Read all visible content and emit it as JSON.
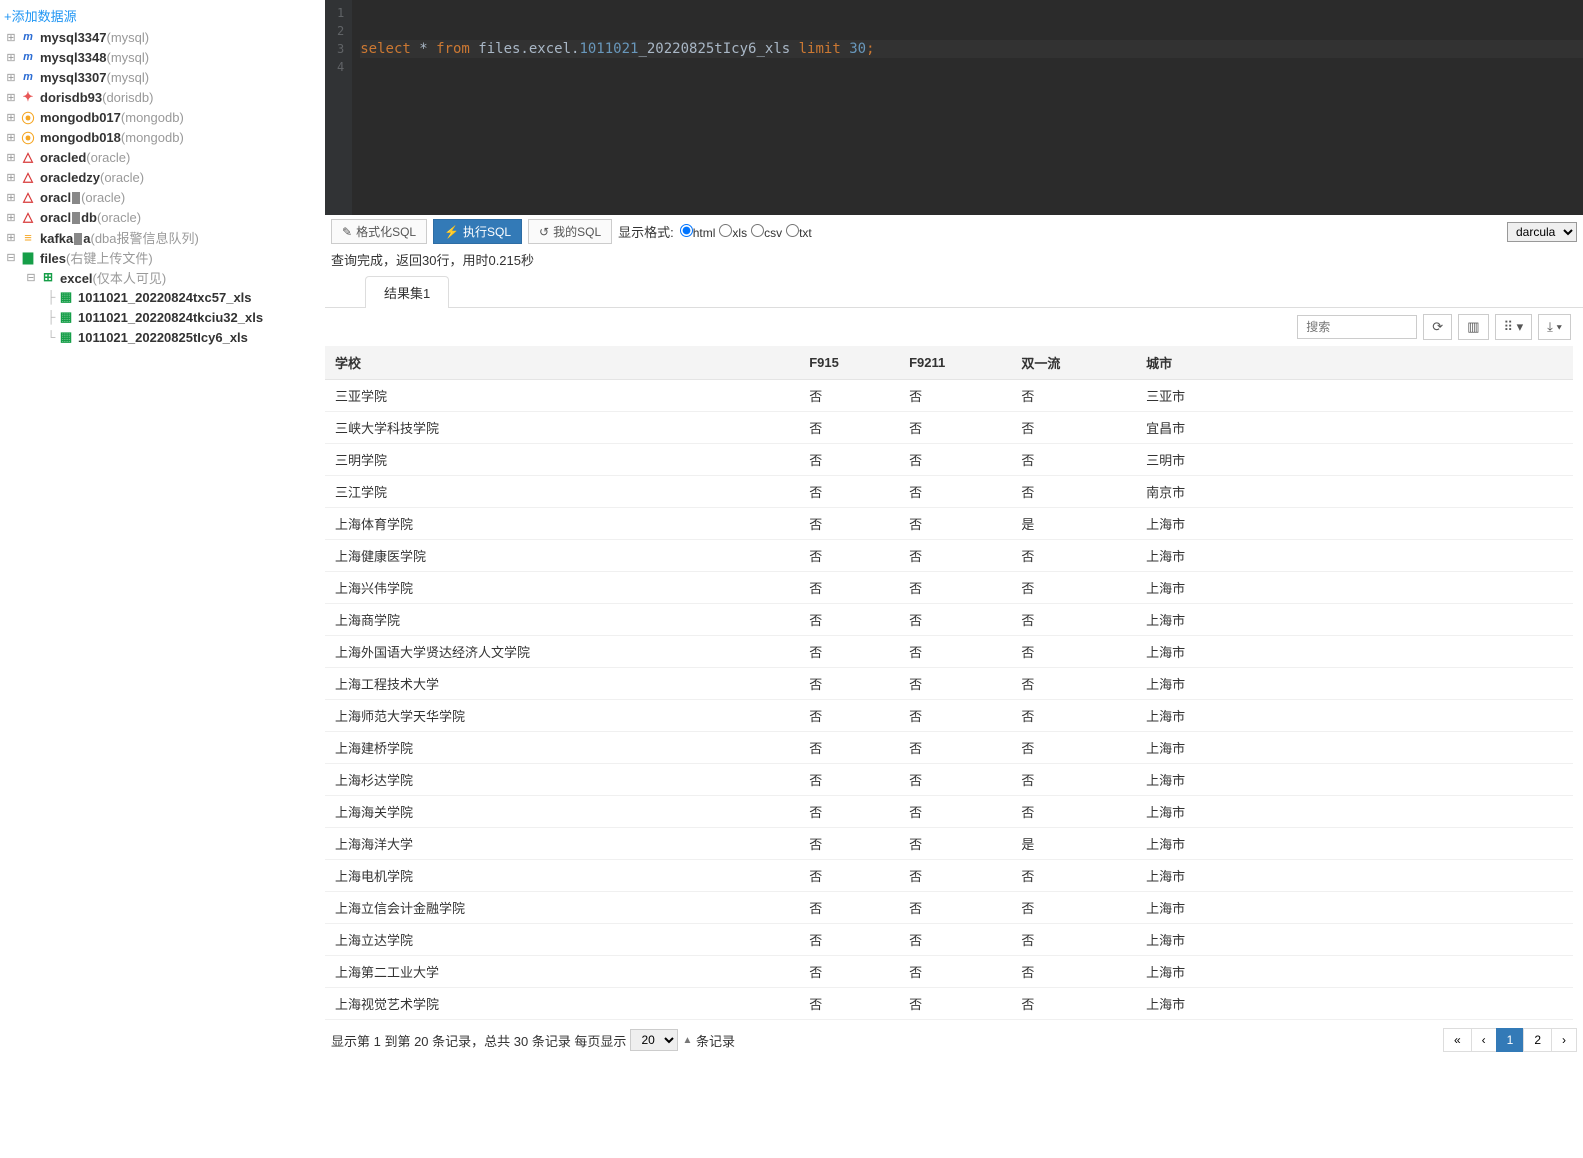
{
  "sidebar": {
    "add_link": "+添加数据源",
    "nodes": [
      {
        "name": "mysql3347",
        "suffix": "(mysql)",
        "icon": "mysql"
      },
      {
        "name": "mysql3348",
        "suffix": "(mysql)",
        "icon": "mysql"
      },
      {
        "name": "mysql3307",
        "suffix": "(mysql)",
        "icon": "mysql"
      },
      {
        "name": "dorisdb93",
        "suffix": "(dorisdb)",
        "icon": "doris"
      },
      {
        "name": "mongodb017",
        "suffix": "(mongodb)",
        "icon": "mongo"
      },
      {
        "name": "mongodb018",
        "suffix": "(mongodb)",
        "icon": "mongo"
      },
      {
        "name": "oracle",
        "name2": "d",
        "suffix": "(oracle)",
        "icon": "oracle"
      },
      {
        "name": "oracle",
        "name2": "dzy",
        "suffix": "(oracle)",
        "icon": "oracle"
      },
      {
        "name": "oracl",
        "name2": "",
        "suffix": "(oracle)",
        "icon": "oracle",
        "ob": true
      },
      {
        "name": "oracl",
        "name2": "db",
        "suffix": "(oracle)",
        "icon": "oracle",
        "ob": true
      },
      {
        "name": "kafka",
        "name2": "a",
        "suffix": "(dba报警信息队列)",
        "icon": "kafka",
        "ob": true
      }
    ],
    "files_node": {
      "name": "files",
      "suffix": "(右键上传文件)"
    },
    "excel_node": {
      "name": "excel",
      "suffix": "(仅本人可见)"
    },
    "excel_files": [
      "1011021_20220824txc57_xls",
      "1011021_20220824tkciu32_xls",
      "1011021_20220825tIcy6_xls"
    ]
  },
  "editor": {
    "line_numbers": [
      "1",
      "2",
      "3",
      "4"
    ],
    "sql": {
      "select": "select",
      "star": "*",
      "from": "from",
      "ident_pre": "files.excel.",
      "ident_num": "1011021",
      "ident_post": "_20220825tIcy6_xls",
      "limit": "limit",
      "limit_val": "30",
      "semi": ";"
    }
  },
  "toolbar": {
    "format": "格式化SQL",
    "execute": "执行SQL",
    "my_sql": "我的SQL",
    "display_label": "显示格式:",
    "formats": [
      "html",
      "xls",
      "csv",
      "txt"
    ],
    "selected_format": "html",
    "theme_options": [
      "darcula"
    ],
    "theme_selected": "darcula"
  },
  "status": "查询完成，返回30行，用时0.215秒",
  "tabs": [
    "结果集1"
  ],
  "results_toolbar": {
    "search_placeholder": "搜索"
  },
  "table": {
    "columns": [
      "学校",
      "F915",
      "F9211",
      "双一流",
      "城市"
    ],
    "rows": [
      [
        "三亚学院",
        "否",
        "否",
        "否",
        "三亚市"
      ],
      [
        "三峡大学科技学院",
        "否",
        "否",
        "否",
        "宜昌市"
      ],
      [
        "三明学院",
        "否",
        "否",
        "否",
        "三明市"
      ],
      [
        "三江学院",
        "否",
        "否",
        "否",
        "南京市"
      ],
      [
        "上海体育学院",
        "否",
        "否",
        "是",
        "上海市"
      ],
      [
        "上海健康医学院",
        "否",
        "否",
        "否",
        "上海市"
      ],
      [
        "上海兴伟学院",
        "否",
        "否",
        "否",
        "上海市"
      ],
      [
        "上海商学院",
        "否",
        "否",
        "否",
        "上海市"
      ],
      [
        "上海外国语大学贤达经济人文学院",
        "否",
        "否",
        "否",
        "上海市"
      ],
      [
        "上海工程技术大学",
        "否",
        "否",
        "否",
        "上海市"
      ],
      [
        "上海师范大学天华学院",
        "否",
        "否",
        "否",
        "上海市"
      ],
      [
        "上海建桥学院",
        "否",
        "否",
        "否",
        "上海市"
      ],
      [
        "上海杉达学院",
        "否",
        "否",
        "否",
        "上海市"
      ],
      [
        "上海海关学院",
        "否",
        "否",
        "否",
        "上海市"
      ],
      [
        "上海海洋大学",
        "否",
        "否",
        "是",
        "上海市"
      ],
      [
        "上海电机学院",
        "否",
        "否",
        "否",
        "上海市"
      ],
      [
        "上海立信会计金融学院",
        "否",
        "否",
        "否",
        "上海市"
      ],
      [
        "上海立达学院",
        "否",
        "否",
        "否",
        "上海市"
      ],
      [
        "上海第二工业大学",
        "否",
        "否",
        "否",
        "上海市"
      ],
      [
        "上海视觉艺术学院",
        "否",
        "否",
        "否",
        "上海市"
      ]
    ]
  },
  "pagination": {
    "summary_pre": "显示第 1 到第 20 条记录，总共 30 条记录  每页显示",
    "page_size": "20",
    "summary_post": "条记录",
    "pages": [
      "«",
      "‹",
      "1",
      "2",
      "›"
    ],
    "active_page": "1"
  }
}
